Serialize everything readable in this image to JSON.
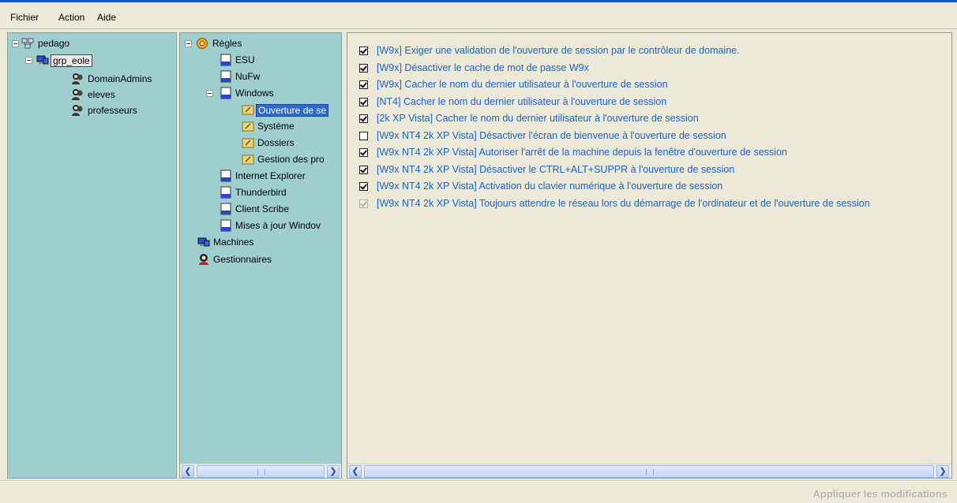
{
  "menu": {
    "file": "Fichier",
    "action": "Action",
    "help": "Aide"
  },
  "groups_tree": {
    "root": "pedago",
    "group": "grp_eole",
    "children": [
      "DomainAdmins",
      "eleves",
      "professeurs"
    ]
  },
  "rules_tree": {
    "root": "Règles",
    "items": {
      "esu": "ESU",
      "nufw": "NuFw",
      "windows": "Windows",
      "ouverture": "Ouverture de se",
      "systeme": "Système",
      "dossiers": "Dossiers",
      "gestion": "Gestion des pro",
      "ie": "Internet Explorer",
      "thunderbird": "Thunderbird",
      "scribe": "Client Scribe",
      "mises": "Mises à jour Windov"
    },
    "machines": "Machines",
    "gestionnaires": "Gestionnaires"
  },
  "policies": [
    {
      "label": "[W9x] Exiger une validation de l'ouverture de session par le contrôleur de domaine.",
      "checked": true,
      "disabled": false
    },
    {
      "label": "[W9x] Désactiver le cache de mot de passe W9x",
      "checked": true,
      "disabled": false
    },
    {
      "label": "[W9x] Cacher le nom du dernier utilisateur à l'ouverture de session",
      "checked": true,
      "disabled": false
    },
    {
      "label": "[NT4] Cacher le nom du dernier utilisateur à l'ouverture de session",
      "checked": true,
      "disabled": false
    },
    {
      "label": "[2k XP Vista] Cacher le nom du dernier utilisateur à l'ouverture de session",
      "checked": true,
      "disabled": false
    },
    {
      "label": "[W9x NT4 2k XP Vista] Désactiver l'écran de bienvenue à l'ouverture de session",
      "checked": false,
      "disabled": false
    },
    {
      "label": "[W9x NT4 2k XP Vista] Autoriser l'arrêt de la machine depuis la fenêtre d'ouverture de session",
      "checked": true,
      "disabled": false
    },
    {
      "label": "[W9x NT4 2k XP Vista] Désactiver le CTRL+ALT+SUPPR à l'ouverture de session",
      "checked": true,
      "disabled": false
    },
    {
      "label": "[W9x NT4 2k XP Vista] Activation du clavier numérique à l'ouverture de session",
      "checked": true,
      "disabled": false
    },
    {
      "label": "[W9x NT4 2k XP Vista] Toujours attendre le réseau lors du démarrage de l'ordinateur et de l'ouverture de session",
      "checked": true,
      "disabled": true
    }
  ],
  "apply_button": "Appliquer les modifications"
}
